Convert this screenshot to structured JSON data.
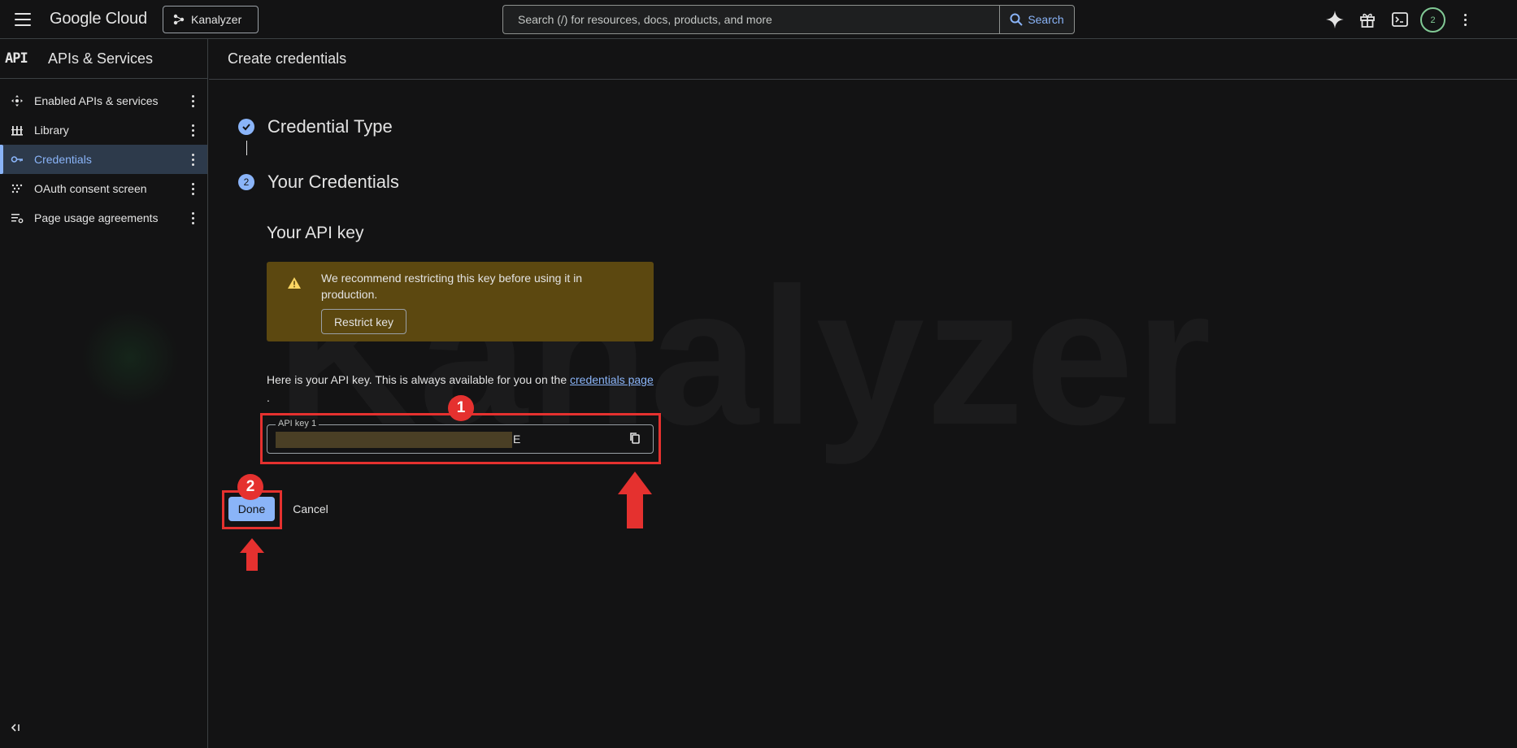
{
  "topbar": {
    "logo": "Google Cloud",
    "project": "Kanalyzer",
    "search_placeholder": "Search (/) for resources, docs, products, and more",
    "search_button": "Search",
    "avatar_initial": "2"
  },
  "sidebar": {
    "logo": "API",
    "title": "APIs & Services",
    "items": [
      {
        "label": "Enabled APIs & services",
        "icon": "hub-icon"
      },
      {
        "label": "Library",
        "icon": "library-icon"
      },
      {
        "label": "Credentials",
        "icon": "key-icon",
        "active": true
      },
      {
        "label": "OAuth consent screen",
        "icon": "consent-icon"
      },
      {
        "label": "Page usage agreements",
        "icon": "settings-list-icon"
      }
    ]
  },
  "main": {
    "header": "Create credentials",
    "steps": [
      {
        "title": "Credential Type",
        "state": "done"
      },
      {
        "number": "2",
        "title": "Your Credentials",
        "state": "current"
      }
    ],
    "api_key_heading": "Your API key",
    "warning": {
      "text": "We recommend restricting this key before using it in production.",
      "button": "Restrict key"
    },
    "info_text": "Here is your API key. This is always available for you on the ",
    "info_link": "credentials page",
    "info_period": ".",
    "key_field": {
      "label": "API key 1",
      "visible_suffix": "E"
    },
    "done_button": "Done",
    "cancel_button": "Cancel"
  },
  "annotations": {
    "badge_1": "1",
    "badge_2": "2",
    "color": "#e5312f"
  },
  "watermark": "Kanalyzer"
}
